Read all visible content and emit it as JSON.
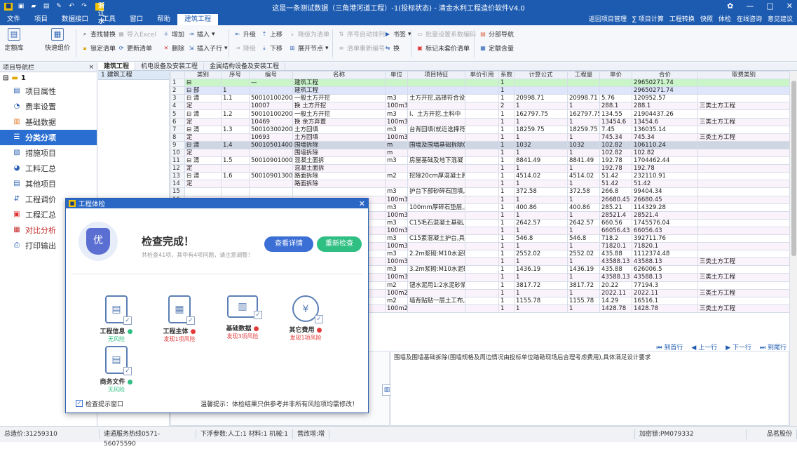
{
  "app": {
    "brand": "浙江水利套装",
    "window_title": "这是一条测试数据（三角港河道工程）-1(投标状态) - 清金水利工程造价软件V4.0"
  },
  "menu": {
    "items": [
      "文件",
      "项目",
      "数据接口",
      "工具",
      "窗口",
      "帮助",
      "建筑工程"
    ],
    "right_links": [
      "返回项目管理",
      "∑ 项目计算",
      "工程转换",
      "快照",
      "体检",
      "在线咨询",
      "意见建议"
    ]
  },
  "ribbon": {
    "big1": "定额库",
    "big2": "快速组价",
    "find_replace": "查找替换",
    "import_excel": "导入Excel",
    "lock_list": "锁定清单",
    "update_list": "更新清单",
    "add": "增加",
    "insert": "插入",
    "delete": "删除",
    "insert_child": "插入子行",
    "upgrade": "升级",
    "move_up": "上移",
    "to_list": "降级为清单",
    "downgrade": "降级",
    "move_down": "下移",
    "expand": "展开节点",
    "auto_seq": "序号自动排列",
    "clear_seq": "清单重新编号",
    "bookmark": "书签",
    "swap": "换",
    "batch_set": "批量设置系数编码",
    "mark_unpriced": "标记未套价清单",
    "section_nav": "分部导航",
    "quota_content": "定额含量"
  },
  "nav": {
    "header": "项目导航栏",
    "close": "×",
    "root_label": "1",
    "items": [
      "项目属性",
      "费率设置",
      "基础数据",
      "分类分项",
      "措施项目",
      "工料汇总",
      "其他项目",
      "工程调价",
      "工程汇总",
      "对比分析",
      "打印输出"
    ]
  },
  "tabs": [
    "建筑工程",
    "机电设备及安装工程",
    "金属结构设备及安装工程"
  ],
  "tree": {
    "item": "建筑工程"
  },
  "grid": {
    "headers": [
      "",
      "类别",
      "序号",
      "编号",
      "名称",
      "单位",
      "项目特征",
      "单价引用",
      "系数",
      "计算公式",
      "工程量",
      "单价",
      "合价",
      "取费类别"
    ],
    "rows": [
      {
        "kind": "top",
        "n": "1",
        "cat": "⊟",
        "seq": "",
        "code": "—",
        "name": "建筑工程",
        "unit": "",
        "feat": "",
        "ref": "",
        "coef": "1",
        "formula": "",
        "qty": "",
        "price": "",
        "total": "29650271.74",
        "fee": ""
      },
      {
        "kind": "part",
        "n": "2",
        "cat": "⊟ 部",
        "seq": "1",
        "code": "",
        "name": "建筑工程",
        "unit": "",
        "feat": "",
        "ref": "",
        "coef": "1",
        "formula": "",
        "qty": "",
        "price": "",
        "total": "29650271.74",
        "fee": ""
      },
      {
        "kind": "qing",
        "n": "3",
        "cat": "⊟ 清",
        "seq": "1.1",
        "code": "500101002001",
        "name": "一般土方开挖",
        "unit": "m3",
        "feat": "土方开挖,选择符合设",
        "ref": "",
        "coef": "1",
        "formula": "20998.71",
        "qty": "20998.71",
        "price": "5.76",
        "total": "120952.57",
        "fee": ""
      },
      {
        "kind": "ding",
        "n": "4",
        "cat": "定",
        "seq": "",
        "code": "10007",
        "name": "换 土方开挖",
        "unit": "100m3",
        "feat": "",
        "ref": "",
        "coef": "2",
        "formula": "1",
        "qty": "1",
        "price": "288.1",
        "total": "288.1",
        "fee": "三类土方工程"
      },
      {
        "kind": "qing",
        "n": "5",
        "cat": "⊟ 清",
        "seq": "1.2",
        "code": "500101002002",
        "name": "一般土方开挖",
        "unit": "m3",
        "feat": "Ⅰ、土方开挖,土料中",
        "ref": "",
        "coef": "1",
        "formula": "162797.75",
        "qty": "162797.75",
        "price": "134.55",
        "total": "21904437.26",
        "fee": ""
      },
      {
        "kind": "ding",
        "n": "6",
        "cat": "定",
        "seq": "",
        "code": "10469",
        "name": "换 余方弃置",
        "unit": "100m3",
        "feat": "",
        "ref": "",
        "coef": "1",
        "formula": "1",
        "qty": "1",
        "price": "13454.6",
        "total": "13454.6",
        "fee": "三类土方工程"
      },
      {
        "kind": "qing",
        "n": "7",
        "cat": "⊟ 清",
        "seq": "1.3",
        "code": "500103002001",
        "name": "土方回填",
        "unit": "m3",
        "feat": "台背回填(就近选择符",
        "ref": "",
        "coef": "1",
        "formula": "18259.75",
        "qty": "18259.75",
        "price": "7.45",
        "total": "136035.14",
        "fee": ""
      },
      {
        "kind": "ding",
        "n": "8",
        "cat": "定",
        "seq": "",
        "code": "10693",
        "name": "土方回填",
        "unit": "100m3",
        "feat": "",
        "ref": "",
        "coef": "1",
        "formula": "1",
        "qty": "1",
        "price": "745.34",
        "total": "745.34",
        "fee": "三类土方工程"
      },
      {
        "kind": "sel",
        "n": "9",
        "cat": "⊟ 清",
        "seq": "1.4",
        "code": "500105014001",
        "name": "围墙拆除",
        "unit": "m",
        "feat": "围墙及围墙基础拆除(",
        "ref": "",
        "coef": "1",
        "formula": "1032",
        "qty": "1032",
        "price": "102.82",
        "total": "106110.24",
        "fee": ""
      },
      {
        "kind": "ding",
        "n": "10",
        "cat": "定",
        "seq": "",
        "code": "",
        "name": "围墙拆除",
        "unit": "m",
        "feat": "",
        "ref": "",
        "coef": "1",
        "formula": "1",
        "qty": "1",
        "price": "102.82",
        "total": "102.82",
        "fee": ""
      },
      {
        "kind": "qing",
        "n": "11",
        "cat": "⊟ 清",
        "seq": "1.5",
        "code": "500109010001",
        "name": "混凝土面拆",
        "unit": "m3",
        "feat": "房屋基础及地下混凝",
        "ref": "",
        "coef": "1",
        "formula": "8841.49",
        "qty": "8841.49",
        "price": "192.78",
        "total": "1704462.44",
        "fee": ""
      },
      {
        "kind": "ding",
        "n": "12",
        "cat": "定",
        "seq": "",
        "code": "",
        "name": "混凝土面拆",
        "unit": "",
        "feat": "",
        "ref": "",
        "coef": "1",
        "formula": "1",
        "qty": "1",
        "price": "192.78",
        "total": "192.78",
        "fee": ""
      },
      {
        "kind": "qing",
        "n": "13",
        "cat": "⊟ 清",
        "seq": "1.6",
        "code": "500109013001",
        "name": "路面拆除",
        "unit": "m2",
        "feat": "挖除20cm厚混凝土路",
        "ref": "",
        "coef": "1",
        "formula": "4514.02",
        "qty": "4514.02",
        "price": "51.42",
        "total": "232110.91",
        "fee": ""
      },
      {
        "kind": "ding",
        "n": "14",
        "cat": "定",
        "seq": "",
        "code": "",
        "name": "路面拆除",
        "unit": "",
        "feat": "",
        "ref": "",
        "coef": "1",
        "formula": "1",
        "qty": "1",
        "price": "51.42",
        "total": "51.42",
        "fee": ""
      },
      {
        "kind": "qing",
        "n": "15",
        "cat": "",
        "seq": "",
        "code": "",
        "name": "",
        "unit": "m3",
        "feat": "护台下部砂碎石回填,",
        "ref": "",
        "coef": "1",
        "formula": "372.58",
        "qty": "372.58",
        "price": "266.8",
        "total": "99404.34",
        "fee": ""
      },
      {
        "kind": "ding",
        "n": "16",
        "cat": "",
        "seq": "",
        "code": "",
        "name": "",
        "unit": "100m3",
        "feat": "",
        "ref": "",
        "coef": "1",
        "formula": "1",
        "qty": "1",
        "price": "26680.45",
        "total": "26680.45",
        "fee": ""
      },
      {
        "kind": "qing",
        "n": "17",
        "cat": "",
        "seq": "",
        "code": "",
        "name": "",
        "unit": "m3",
        "feat": "100mm厚碎石垫层,具",
        "ref": "",
        "coef": "1",
        "formula": "400.86",
        "qty": "400.86",
        "price": "285.21",
        "total": "114329.28",
        "fee": ""
      },
      {
        "kind": "ding",
        "n": "18",
        "cat": "",
        "seq": "",
        "code": "",
        "name": "",
        "unit": "100m3",
        "feat": "",
        "ref": "",
        "coef": "1",
        "formula": "1",
        "qty": "1",
        "price": "28521.4",
        "total": "28521.4",
        "fee": ""
      },
      {
        "kind": "qing",
        "n": "19",
        "cat": "",
        "seq": "",
        "code": "",
        "name": "",
        "unit": "m3",
        "feat": "C15毛石混凝土基础,",
        "ref": "",
        "coef": "1",
        "formula": "2642.57",
        "qty": "2642.57",
        "price": "660.56",
        "total": "1745576.04",
        "fee": ""
      },
      {
        "kind": "ding",
        "n": "20",
        "cat": "",
        "seq": "",
        "code": "",
        "name": "",
        "unit": "100m3",
        "feat": "",
        "ref": "",
        "coef": "1",
        "formula": "1",
        "qty": "1",
        "price": "66056.43",
        "total": "66056.43",
        "fee": ""
      },
      {
        "kind": "qing",
        "n": "21",
        "cat": "",
        "seq": "",
        "code": "",
        "name": "",
        "unit": "m3",
        "feat": "C15素混凝土护台,具",
        "ref": "",
        "coef": "1",
        "formula": "546.8",
        "qty": "546.8",
        "price": "718.2",
        "total": "392711.76",
        "fee": ""
      },
      {
        "kind": "ding",
        "n": "22",
        "cat": "",
        "seq": "",
        "code": "",
        "name": "",
        "unit": "100m3",
        "feat": "",
        "ref": "",
        "coef": "1",
        "formula": "1",
        "qty": "1",
        "price": "71820.1",
        "total": "71820.1",
        "fee": ""
      },
      {
        "kind": "qing",
        "n": "23",
        "cat": "",
        "seq": "",
        "code": "",
        "name": "",
        "unit": "m3",
        "feat": "2.2m浆砌:M10水泥砂",
        "ref": "",
        "coef": "1",
        "formula": "2552.02",
        "qty": "2552.02",
        "price": "435.88",
        "total": "1112374.48",
        "fee": ""
      },
      {
        "kind": "ding",
        "n": "24",
        "cat": "",
        "seq": "",
        "code": "",
        "name": "",
        "unit": "100m3",
        "feat": "",
        "ref": "",
        "coef": "1",
        "formula": "1",
        "qty": "1",
        "price": "43588.13",
        "total": "43588.13",
        "fee": "三类土方工程"
      },
      {
        "kind": "qing",
        "n": "25",
        "cat": "",
        "seq": "",
        "code": "",
        "name": "",
        "unit": "m3",
        "feat": "3.2m浆砌:M10水泥砂",
        "ref": "",
        "coef": "1",
        "formula": "1436.19",
        "qty": "1436.19",
        "price": "435.88",
        "total": "626006.5",
        "fee": ""
      },
      {
        "kind": "ding",
        "n": "26",
        "cat": "",
        "seq": "",
        "code": "",
        "name": "",
        "unit": "100m3",
        "feat": "",
        "ref": "",
        "coef": "1",
        "formula": "1",
        "qty": "1",
        "price": "43588.13",
        "total": "43588.13",
        "fee": "三类土方工程"
      },
      {
        "kind": "qing",
        "n": "27",
        "cat": "",
        "seq": "",
        "code": "",
        "name": "",
        "unit": "m2",
        "feat": "钮水泥用1:2水泥砂浆",
        "ref": "",
        "coef": "1",
        "formula": "3817.72",
        "qty": "3817.72",
        "price": "20.22",
        "total": "77194.3",
        "fee": ""
      },
      {
        "kind": "ding",
        "n": "28",
        "cat": "",
        "seq": "",
        "code": "",
        "name": "",
        "unit": "100m2",
        "feat": "",
        "ref": "",
        "coef": "1",
        "formula": "1",
        "qty": "1",
        "price": "2022.11",
        "total": "2022.11",
        "fee": "三类土方工程"
      },
      {
        "kind": "qing",
        "n": "29",
        "cat": "",
        "seq": "",
        "code": "",
        "name": "",
        "unit": "m2",
        "feat": "墙背贴贴一层土工布,",
        "ref": "",
        "coef": "1",
        "formula": "1155.78",
        "qty": "1155.78",
        "price": "14.29",
        "total": "16516.1",
        "fee": ""
      },
      {
        "kind": "ding",
        "n": "30",
        "cat": "",
        "seq": "",
        "code": "",
        "name": "",
        "unit": "100m2",
        "feat": "",
        "ref": "",
        "coef": "1",
        "formula": "1",
        "qty": "1",
        "price": "1428.78",
        "total": "1428.78",
        "fee": "三类土方工程"
      }
    ]
  },
  "pager": {
    "first": "到首行",
    "prev": "上一行",
    "next": "下一行",
    "last": "到尾行"
  },
  "description": "围墙及围墙基础拆除(围墙规格及周边情况由投标单位踏勘现场后合理考虑费用),具体满足设计要求",
  "dialog": {
    "title": "工程体检",
    "shield_text": "优",
    "heading": "检查完成！",
    "sub": "共检查41项，其中有4项问题，请注意调整！",
    "detail_btn": "查看详情",
    "recheck_btn": "重新检查",
    "cards": [
      {
        "name": "工程信息",
        "status": "无风险",
        "ok": true
      },
      {
        "name": "工程主体",
        "status": "发现1项风险",
        "ok": false
      },
      {
        "name": "基础数据",
        "status": "发现3项风险",
        "ok": false
      },
      {
        "name": "其它费用",
        "status": "发现1项风险",
        "ok": false
      },
      {
        "name": "商务文件",
        "status": "无风险",
        "ok": true
      }
    ],
    "checkbox_label": "检查提示窗口",
    "tip": "温馨提示：体检结果只供参考并非所有风险项均需修改！"
  },
  "status": {
    "total": "总造价:31259310",
    "service": "速通服务热线0571-56075590",
    "params": "下浮参数:人工:1 材料:1 机械:1",
    "mode": "营改增:增",
    "lock": "加密锁:PM079332",
    "company": "品茗股份"
  },
  "colors": {
    "brand_blue": "#1d5bb1",
    "accent": "#3b6fd6",
    "ok_green": "#2fbf83",
    "risk_red": "#e03b3b"
  }
}
